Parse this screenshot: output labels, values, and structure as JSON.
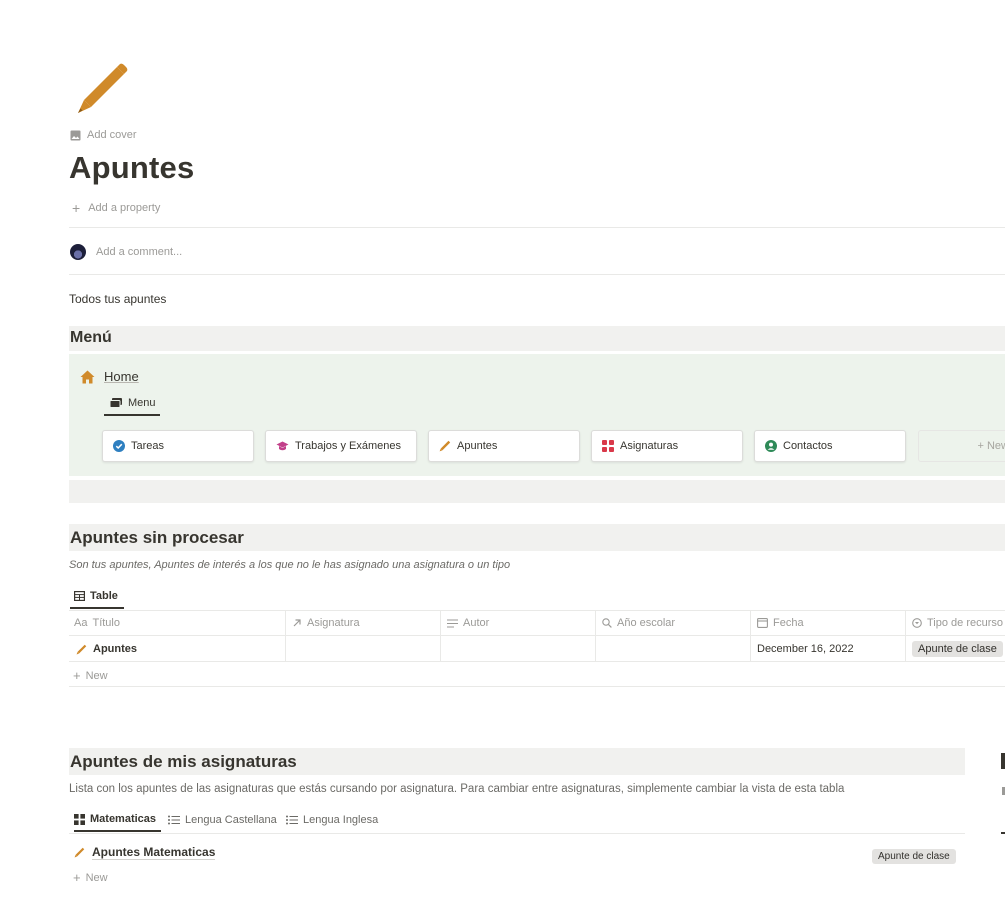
{
  "header": {
    "add_cover": "Add cover",
    "title": "Apuntes",
    "add_property": "Add a property",
    "add_comment": "Add a comment...",
    "description": "Todos tus apuntes",
    "page_icon": "pencil-icon"
  },
  "menu": {
    "heading": "Menú",
    "home_label": "Home",
    "tab_label": "Menu",
    "cards": [
      {
        "label": "Tareas",
        "icon": "check-circle-icon",
        "color": "#2e7fc0"
      },
      {
        "label": "Trabajos y Exámenes",
        "icon": "graduation-cap-icon",
        "color": "#c2408a"
      },
      {
        "label": "Apuntes",
        "icon": "pencil-icon",
        "color": "#d08a2a"
      },
      {
        "label": "Asignaturas",
        "icon": "grid-icon",
        "color": "#d9394a"
      },
      {
        "label": "Contactos",
        "icon": "person-circle-icon",
        "color": "#2e8a58"
      }
    ],
    "new_label": "+ New"
  },
  "unprocessed": {
    "heading": "Apuntes sin procesar",
    "subtitle": "Son tus apuntes, Apuntes de interés a los que no le has asignado una asignatura o un tipo",
    "view_tab": "Table",
    "columns": [
      "Título",
      "Asignatura",
      "Autor",
      "Año escolar",
      "Fecha",
      "Tipo de recurso"
    ],
    "title_prefix": "Aa",
    "rows": [
      {
        "title": "Apuntes",
        "asignatura": "",
        "autor": "",
        "anio": "",
        "fecha": "December 16, 2022",
        "tipo": "Apunte de clase"
      }
    ],
    "new_label": "New"
  },
  "subjects": {
    "heading": "Apuntes de mis asignaturas",
    "subtitle": "Lista con los apuntes de las asignaturas que estás cursando por asignatura. Para cambiar entre asignaturas, simplemente cambiar la vista de esta tabla",
    "tabs": [
      {
        "label": "Matematicas",
        "active": true
      },
      {
        "label": "Lengua Castellana",
        "active": false
      },
      {
        "label": "Lengua Inglesa",
        "active": false
      }
    ],
    "items": [
      {
        "title": "Apuntes Matematicas",
        "tag": "Apunte de clase"
      }
    ],
    "new_label": "New"
  },
  "colors": {
    "text": "#37352f",
    "muted": "#9b9a97",
    "callout_bg": "#edf3ec",
    "heading_bg": "#f1f1ef",
    "pencil": "#d08a2a"
  }
}
